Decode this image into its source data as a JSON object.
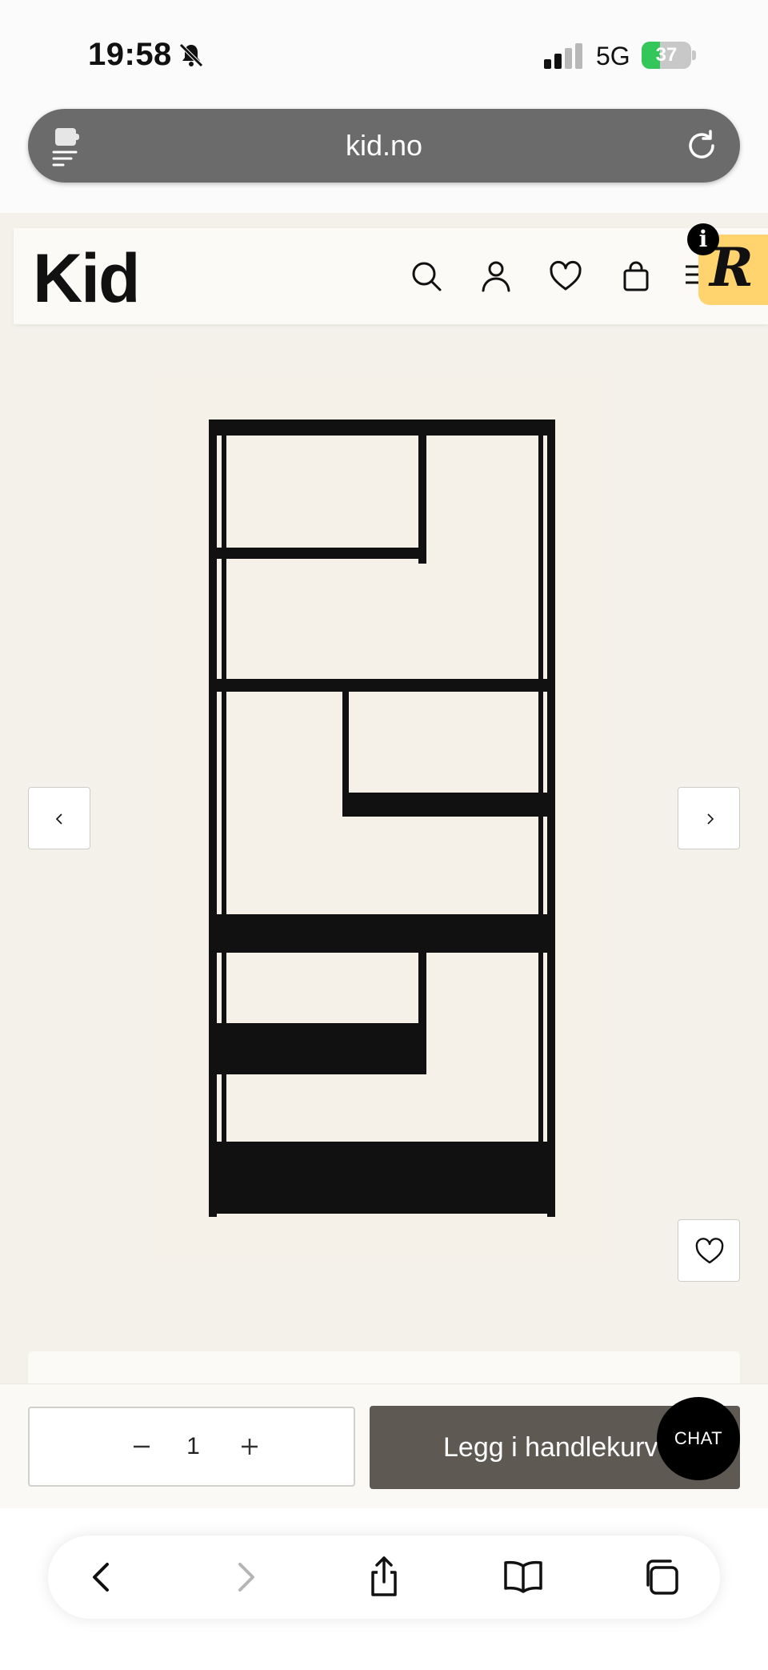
{
  "status": {
    "time": "19:58",
    "network": "5G",
    "battery_percent": "37",
    "battery_level": 0.37
  },
  "browser": {
    "url": "kid.no"
  },
  "site": {
    "logo": "Kid",
    "badge_letter": "R",
    "info_label": "i"
  },
  "icons": {
    "header": [
      "search-icon",
      "account-icon",
      "heart-icon",
      "bag-icon",
      "menu-icon"
    ],
    "toolbar": [
      "back-icon",
      "forward-icon",
      "share-icon",
      "bookmarks-icon",
      "tabs-icon"
    ]
  },
  "cart": {
    "quantity": "1",
    "add_label": "Legg i handlekurv",
    "chat_label": "CHAT"
  },
  "colors": {
    "page_background": "#f4f1eb",
    "header_background": "#fbfaf6",
    "button_dark": "#5f5954",
    "badge_yellow": "#ffd36e",
    "battery_green": "#33c759"
  }
}
